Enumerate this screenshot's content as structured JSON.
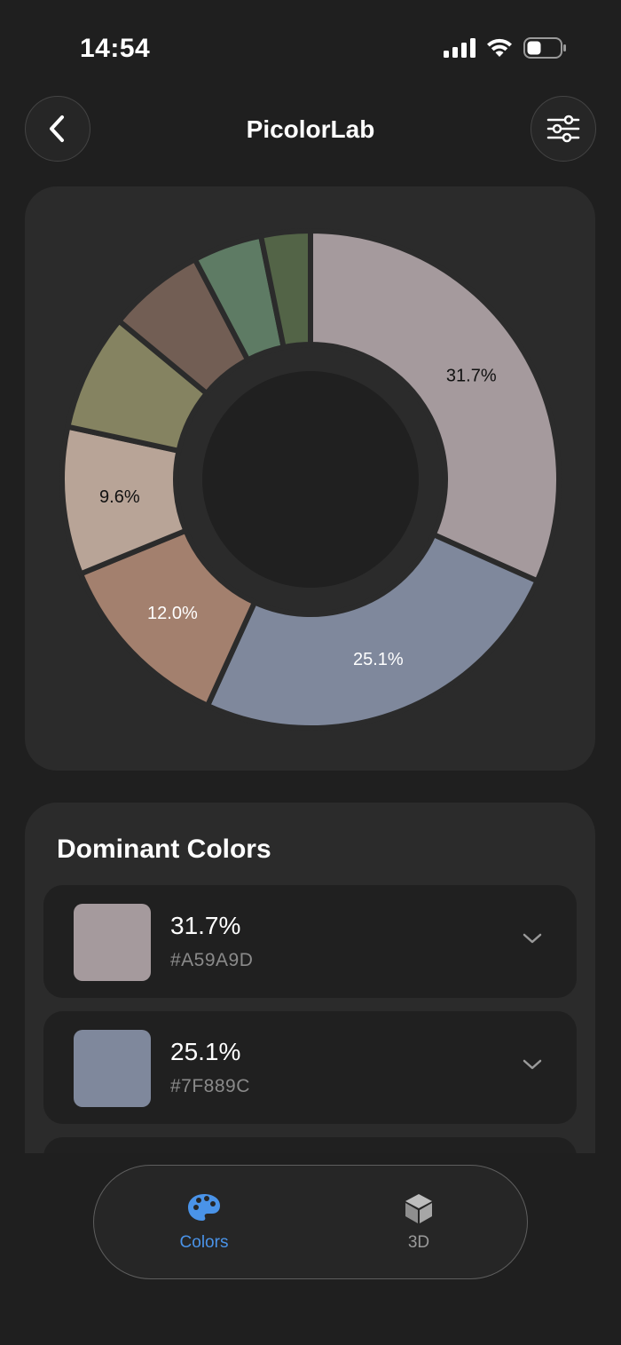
{
  "status": {
    "time": "14:54"
  },
  "nav": {
    "title": "PicolorLab"
  },
  "chart_data": {
    "type": "pie",
    "style": "donut",
    "slices": [
      {
        "label": "31.7%",
        "value": 31.7,
        "color": "#A59A9D",
        "label_color": "#111111",
        "show_label": true
      },
      {
        "label": "25.1%",
        "value": 25.1,
        "color": "#7F889C",
        "label_color": "#ffffff",
        "show_label": true
      },
      {
        "label": "12.0%",
        "value": 12.0,
        "color": "#A3806E",
        "label_color": "#ffffff",
        "show_label": true
      },
      {
        "label": "9.6%",
        "value": 9.6,
        "color": "#B8A497",
        "label_color": "#111111",
        "show_label": true
      },
      {
        "label": "",
        "value": 7.6,
        "color": "#858361",
        "label_color": "#111111",
        "show_label": false
      },
      {
        "label": "",
        "value": 6.3,
        "color": "#725E54",
        "label_color": "#ffffff",
        "show_label": false
      },
      {
        "label": "",
        "value": 4.5,
        "color": "#5E7B64",
        "label_color": "#ffffff",
        "show_label": false
      },
      {
        "label": "",
        "value": 3.2,
        "color": "#536447",
        "label_color": "#ffffff",
        "show_label": false
      }
    ]
  },
  "dominant": {
    "title": "Dominant Colors",
    "items": [
      {
        "percent": "31.7%",
        "hex": "#A59A9D",
        "color": "#A59A9D"
      },
      {
        "percent": "25.1%",
        "hex": "#7F889C",
        "color": "#7F889C"
      }
    ]
  },
  "tabs": [
    {
      "label": "Colors",
      "icon": "palette-icon",
      "active": true
    },
    {
      "label": "3D",
      "icon": "cube-icon",
      "active": false
    }
  ]
}
